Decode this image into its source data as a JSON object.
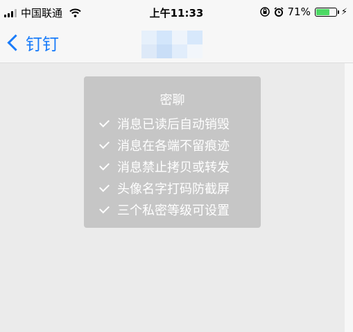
{
  "status_bar": {
    "carrier": "中国联通",
    "time": "上午11:33",
    "battery_percent": "71%",
    "battery_level": 0.71,
    "battery_color": "#4cd964"
  },
  "nav": {
    "back_label": "钉钉",
    "accent_color": "#1a7cfa"
  },
  "card": {
    "title": "密聊",
    "features": [
      "消息已读后自动销毁",
      "消息在各端不留痕迹",
      "消息禁止拷贝或转发",
      "头像名字打码防截屏",
      "三个私密等级可设置"
    ]
  }
}
